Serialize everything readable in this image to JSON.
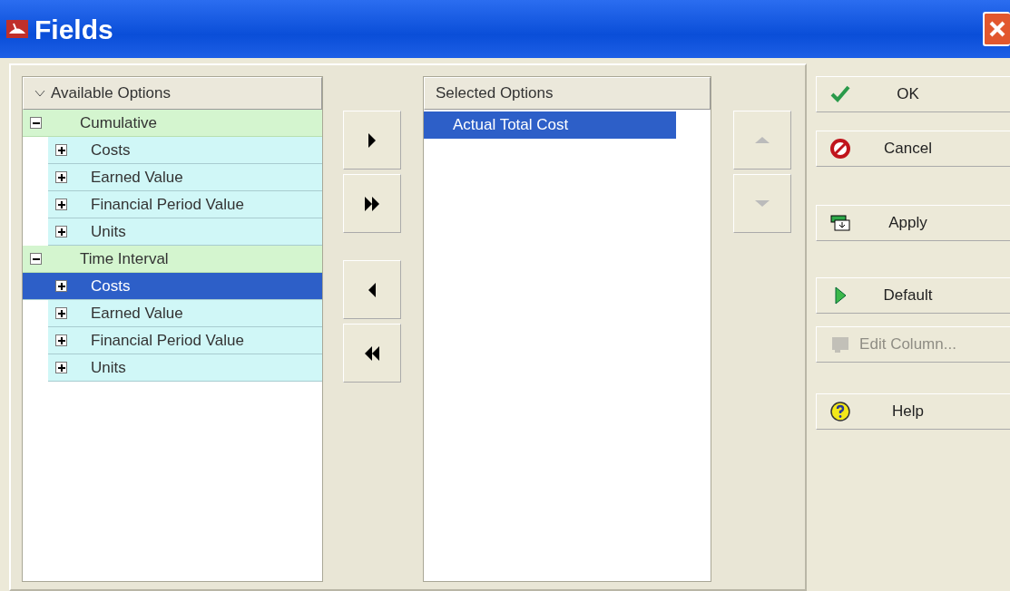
{
  "window": {
    "title": "Fields"
  },
  "available": {
    "header": "Available Options",
    "groups": [
      {
        "label": "Cumulative",
        "expanded": true,
        "children": [
          {
            "label": "Costs",
            "expanded": false,
            "selected": false
          },
          {
            "label": "Earned Value",
            "expanded": false,
            "selected": false
          },
          {
            "label": "Financial Period Value",
            "expanded": false,
            "selected": false
          },
          {
            "label": "Units",
            "expanded": false,
            "selected": false
          }
        ]
      },
      {
        "label": "Time Interval",
        "expanded": true,
        "children": [
          {
            "label": "Costs",
            "expanded": false,
            "selected": true
          },
          {
            "label": "Earned Value",
            "expanded": false,
            "selected": false
          },
          {
            "label": "Financial Period Value",
            "expanded": false,
            "selected": false
          },
          {
            "label": "Units",
            "expanded": false,
            "selected": false
          }
        ]
      }
    ]
  },
  "transfer_buttons": [
    {
      "kind": "add"
    },
    {
      "kind": "add_all"
    },
    {
      "kind": "remove"
    },
    {
      "kind": "remove_all"
    }
  ],
  "selected": {
    "header": "Selected Options",
    "items": [
      {
        "label": "Actual Total Cost",
        "selected": true
      }
    ]
  },
  "order_buttons": [
    {
      "kind": "up",
      "disabled": true
    },
    {
      "kind": "down",
      "disabled": true
    }
  ],
  "action_buttons": [
    {
      "kind": "ok",
      "label": "OK",
      "disabled": false
    },
    {
      "kind": "cancel",
      "label": "Cancel",
      "disabled": false
    },
    {
      "kind": "apply",
      "label": "Apply",
      "disabled": false
    },
    {
      "kind": "default",
      "label": "Default",
      "disabled": false
    },
    {
      "kind": "edit",
      "label": "Edit Column...",
      "disabled": true
    },
    {
      "kind": "help",
      "label": "Help",
      "disabled": false
    }
  ]
}
